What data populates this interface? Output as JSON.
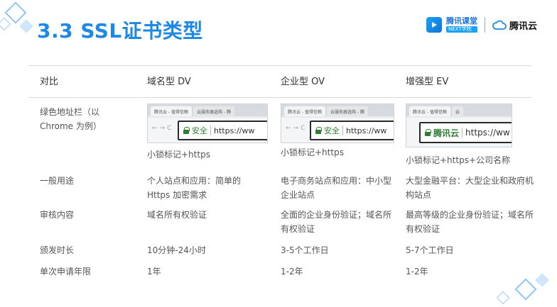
{
  "title": "3.3 SSL证书类型",
  "logos": {
    "tencent_class": "腾讯课堂",
    "tencent_class_sub": "NEXT学院",
    "tencent_cloud": "腾讯云"
  },
  "table": {
    "headers": [
      "对比",
      "域名型 DV",
      "企业型 OV",
      "增强型 EV"
    ],
    "address_bar_label": "绿色地址栏（以 Chrome 为例）",
    "screenshots": {
      "dv": {
        "tab1": "腾讯云 - 值得信赖",
        "tab2": "云服务器选购 - 腾",
        "secure": "安全",
        "url": "https://ww"
      },
      "ov": {
        "tab1": "腾讯云 - 值得信赖",
        "tab2": "云服务器选购 - 腾",
        "secure": "安全",
        "url": "https://ww"
      },
      "ev": {
        "tab1": "腾讯云 - 值得信赖",
        "tab2": "云",
        "secure": "腾讯云",
        "url": "https://ww"
      }
    },
    "address_bar_values": [
      "小锁标记+https",
      "小锁标记+https",
      "小锁标记+https+公司名称"
    ],
    "rows": [
      {
        "label": "一般用途",
        "values": [
          "个人站点和应用：简单的 Https 加密需求",
          "电子商务站点和应用：中小型企业站点",
          "大型金融平台：大型企业和政府机构站点"
        ]
      },
      {
        "label": "审核内容",
        "values": [
          "域名所有权验证",
          "全面的企业身份验证；域名所有权验证",
          "最高等级的企业身份验证；域名所有权验证"
        ]
      },
      {
        "label": "颁发时长",
        "values": [
          "10分钟-24小时",
          "3-5个工作日",
          "5-7个工作日"
        ]
      },
      {
        "label": "单次申请年限",
        "values": [
          "1年",
          "1-2年",
          "1-2年"
        ]
      }
    ]
  },
  "colors": {
    "accent": "#1e88e5",
    "secure_green": "#2e7d32"
  }
}
